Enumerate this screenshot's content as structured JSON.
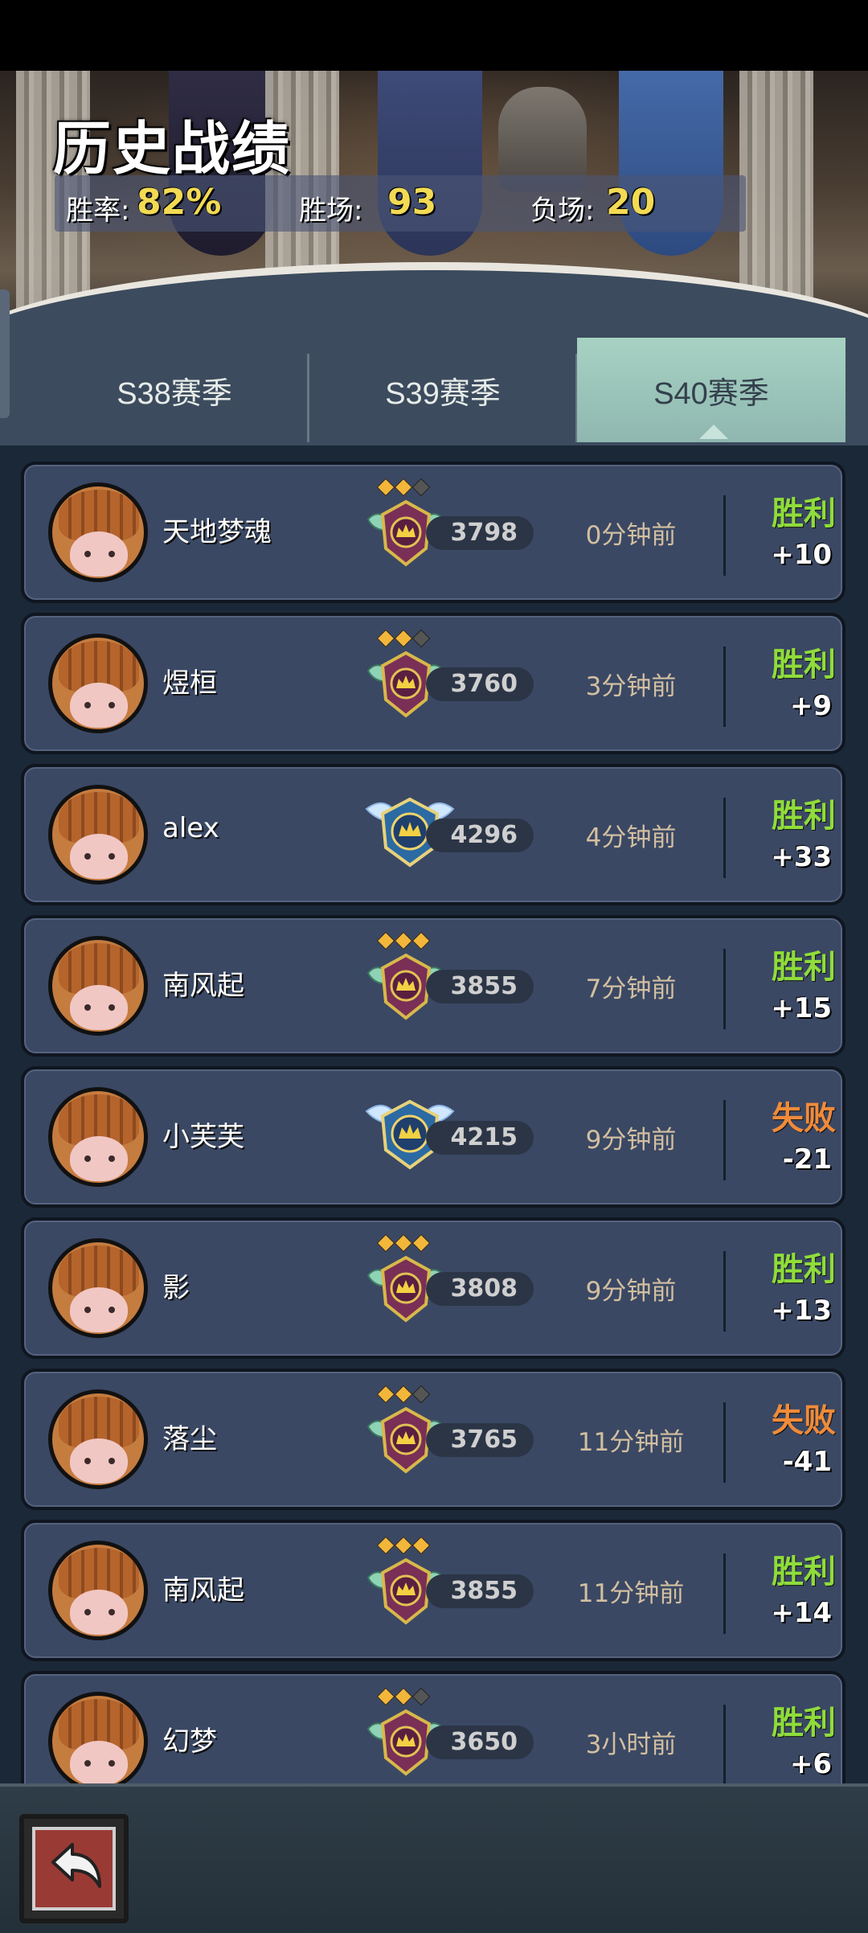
{
  "header": {
    "title": "历史战绩",
    "stats": {
      "win_rate_label": "胜率:",
      "win_rate_value": "82%",
      "wins_label": "胜场:",
      "wins_value": "93",
      "losses_label": "负场:",
      "losses_value": "20"
    }
  },
  "tabs": [
    {
      "label": "S38赛季",
      "active": false
    },
    {
      "label": "S39赛季",
      "active": false
    },
    {
      "label": "S40赛季",
      "active": true
    }
  ],
  "colors": {
    "win": "#8fdc3b",
    "loss": "#f08b3a",
    "stat_value": "#f3da54",
    "active_tab": "#a7d2c3"
  },
  "matches": [
    {
      "name": "天地梦魂",
      "rank_icon": "gold-crown-badge",
      "stars": 2,
      "score": "3798",
      "time": "0分钟前",
      "result": "胜利",
      "change": "+10"
    },
    {
      "name": "煜桓",
      "rank_icon": "gold-crown-badge",
      "stars": 2,
      "score": "3760",
      "time": "3分钟前",
      "result": "胜利",
      "change": "+9"
    },
    {
      "name": "alex",
      "rank_icon": "winged-crown-badge",
      "stars": 0,
      "score": "4296",
      "time": "4分钟前",
      "result": "胜利",
      "change": "+33"
    },
    {
      "name": "南风起",
      "rank_icon": "gold-crown-badge",
      "stars": 3,
      "score": "3855",
      "time": "7分钟前",
      "result": "胜利",
      "change": "+15"
    },
    {
      "name": "小芙芙",
      "rank_icon": "winged-crown-badge",
      "stars": 0,
      "score": "4215",
      "time": "9分钟前",
      "result": "失败",
      "change": "-21"
    },
    {
      "name": "影",
      "rank_icon": "gold-crown-badge",
      "stars": 3,
      "score": "3808",
      "time": "9分钟前",
      "result": "胜利",
      "change": "+13"
    },
    {
      "name": "落尘",
      "rank_icon": "gold-crown-badge",
      "stars": 2,
      "score": "3765",
      "time": "11分钟前",
      "result": "失败",
      "change": "-41"
    },
    {
      "name": "南风起",
      "rank_icon": "gold-crown-badge",
      "stars": 3,
      "score": "3855",
      "time": "11分钟前",
      "result": "胜利",
      "change": "+14"
    },
    {
      "name": "幻梦",
      "rank_icon": "gold-crown-badge",
      "stars": 2,
      "score": "3650",
      "time": "3小时前",
      "result": "胜利",
      "change": "+6"
    }
  ],
  "bottom": {
    "back_icon": "back-arrow-icon"
  }
}
